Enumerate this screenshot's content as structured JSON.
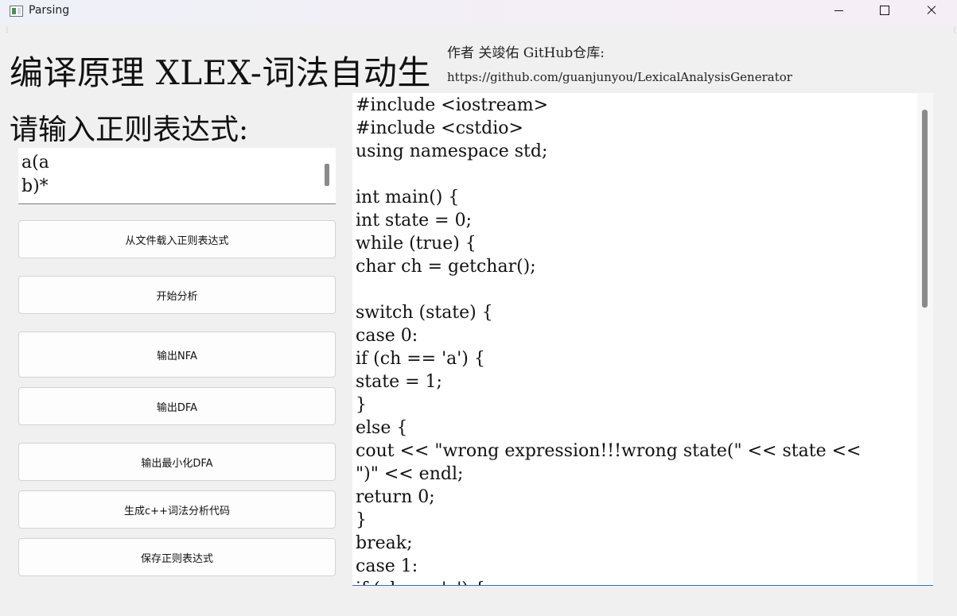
{
  "window": {
    "title": "Parsing",
    "grip": "⋮"
  },
  "header": {
    "title": "编译原理 XLEX-词法自动生",
    "author": "作者 关竣佑 GitHub仓库:",
    "repo_url": "https://github.com/guanjunyou/LexicalAnalysisGenerator"
  },
  "input": {
    "prompt": "请输入正则表达式:",
    "regex_value": "a(a\nb)*"
  },
  "buttons": {
    "load_from_file": "从文件载入正则表达式",
    "start_analysis": "开始分析",
    "output_nfa": "输出NFA",
    "output_dfa": "输出DFA",
    "output_min_dfa": "输出最小化DFA",
    "generate_code": "生成c++词法分析代码",
    "save_regex": "保存正则表达式"
  },
  "output": {
    "code": "#include <iostream>\n#include <cstdio>\nusing namespace std;\n\nint main() {\nint state = 0;\nwhile (true) {\nchar ch = getchar();\n\nswitch (state) {\ncase 0:\nif (ch == 'a') {\nstate = 1;\n}\nelse {\ncout << \"wrong expression!!!wrong state(\" << state <<\n\")\" << endl;\nreturn 0;\n}\nbreak;\ncase 1:\nif (ch == 'a') {"
  }
}
